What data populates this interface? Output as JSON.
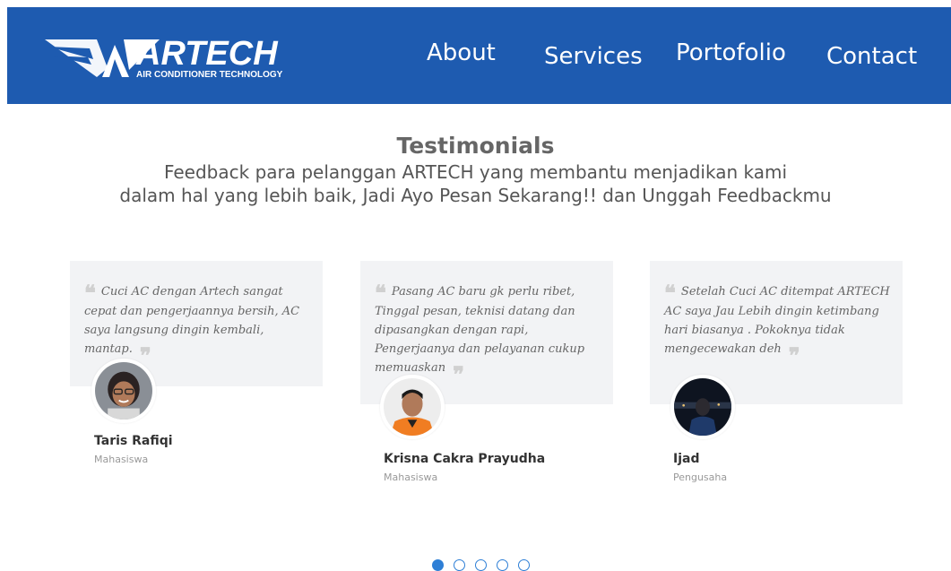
{
  "header": {
    "logo_text": "ARTECH",
    "logo_subtext": "AIR CONDITIONER TECHNOLOGY",
    "nav": {
      "about": "About",
      "services": "Services",
      "portofolio": "Portofolio",
      "contact": "Contact"
    },
    "bg_color": "#1e5bb0"
  },
  "section": {
    "title": "Testimonials",
    "subtitle_line1": "Feedback para pelanggan ARTECH yang membantu menjadikan kami",
    "subtitle_line2": "dalam hal yang lebih baik, Jadi Ayo Pesan Sekarang!! dan Unggah Feedbackmu"
  },
  "testimonials": [
    {
      "quote": "Cuci AC dengan Artech sangat cepat dan pengerjaannya bersih, AC saya langsung dingin kembali, mantap.",
      "name": "Taris Rafiqi",
      "role": "Mahasiswa"
    },
    {
      "quote": "Pasang AC baru gk perlu ribet, Tinggal pesan, teknisi datang dan dipasangkan dengan rapi, Pengerjaanya dan pelayanan cukup memuaskan",
      "name": "Krisna Cakra Prayudha",
      "role": "Mahasiswa"
    },
    {
      "quote": "Setelah Cuci AC ditempat ARTECH AC saya Jau Lebih dingin ketimbang hari biasanya . Pokoknya tidak mengecewakan deh",
      "name": "Ijad",
      "role": "Pengusaha"
    }
  ],
  "carousel": {
    "total": 5,
    "active": 1,
    "accent_color": "#2e7fd6"
  }
}
